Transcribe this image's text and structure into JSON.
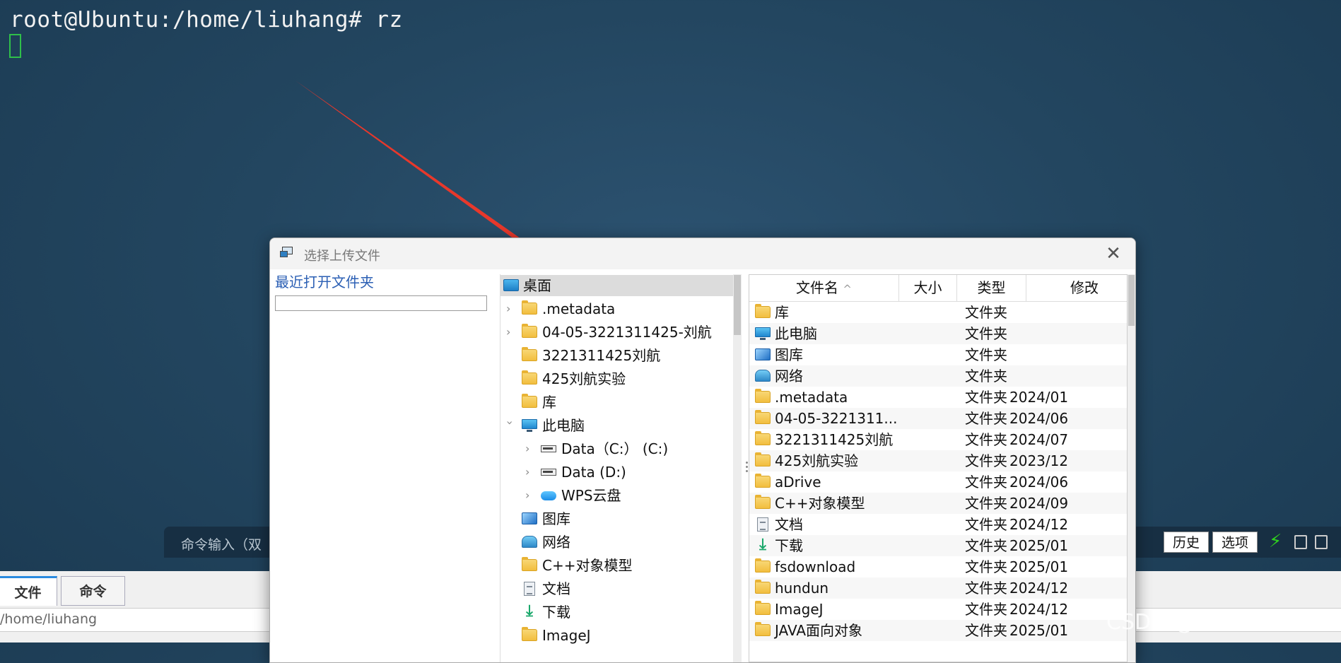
{
  "terminal": {
    "prompt_line": "root@Ubuntu:/home/liuhang# rz"
  },
  "command_bar": {
    "hint": "命令输入（双",
    "history_button": "历史",
    "options_button": "选项"
  },
  "bottom_panel": {
    "tabs": [
      {
        "label": "文件"
      },
      {
        "label": "命令"
      }
    ],
    "path": "/home/liuhang"
  },
  "dialog": {
    "title": "选择上传文件",
    "close_glyph": "✕",
    "recent_folders_label": "最近打开文件夹",
    "tree": [
      {
        "label": "桌面",
        "icon": "desktop-icon"
      },
      {
        "label": ".metadata",
        "icon": "folder-icon"
      },
      {
        "label": "04-05-3221311425-刘航",
        "icon": "folder-icon"
      },
      {
        "label": "3221311425刘航",
        "icon": "folder-icon"
      },
      {
        "label": "425刘航实验",
        "icon": "folder-icon"
      },
      {
        "label": "库",
        "icon": "folder-icon"
      },
      {
        "label": "此电脑",
        "icon": "computer-icon"
      },
      {
        "label": "Data（C:） (C:)",
        "icon": "drive-icon"
      },
      {
        "label": "Data (D:)",
        "icon": "drive-icon"
      },
      {
        "label": "WPS云盘",
        "icon": "cloud-icon"
      },
      {
        "label": "图库",
        "icon": "pictures-icon"
      },
      {
        "label": "网络",
        "icon": "network-icon"
      },
      {
        "label": "C++对象模型",
        "icon": "folder-icon"
      },
      {
        "label": "文档",
        "icon": "document-icon"
      },
      {
        "label": "下载",
        "icon": "download-icon"
      },
      {
        "label": "ImageJ",
        "icon": "folder-icon"
      }
    ],
    "columns": {
      "name": "文件名",
      "size": "大小",
      "type": "类型",
      "modified": "修改"
    },
    "sort_glyph": "^",
    "files": [
      {
        "name": "库",
        "type": "文件夹",
        "modified": "",
        "icon": "folder-icon"
      },
      {
        "name": "此电脑",
        "type": "文件夹",
        "modified": "",
        "icon": "computer-icon"
      },
      {
        "name": "图库",
        "type": "文件夹",
        "modified": "",
        "icon": "pictures-icon"
      },
      {
        "name": "网络",
        "type": "文件夹",
        "modified": "",
        "icon": "network-icon"
      },
      {
        "name": ".metadata",
        "type": "文件夹",
        "modified": "2024/01",
        "icon": "folder-icon"
      },
      {
        "name": "04-05-3221311...",
        "type": "文件夹",
        "modified": "2024/06",
        "icon": "folder-icon"
      },
      {
        "name": "3221311425刘航",
        "type": "文件夹",
        "modified": "2024/07",
        "icon": "folder-icon"
      },
      {
        "name": "425刘航实验",
        "type": "文件夹",
        "modified": "2023/12",
        "icon": "folder-icon"
      },
      {
        "name": "aDrive",
        "type": "文件夹",
        "modified": "2024/06",
        "icon": "folder-icon"
      },
      {
        "name": "C++对象模型",
        "type": "文件夹",
        "modified": "2024/09",
        "icon": "folder-icon"
      },
      {
        "name": "文档",
        "type": "文件夹",
        "modified": "2024/12",
        "icon": "document-icon"
      },
      {
        "name": "下载",
        "type": "文件夹",
        "modified": "2025/01",
        "icon": "download-icon"
      },
      {
        "name": "fsdownload",
        "type": "文件夹",
        "modified": "2025/01",
        "icon": "folder-icon"
      },
      {
        "name": "hundun",
        "type": "文件夹",
        "modified": "2024/12",
        "icon": "folder-icon"
      },
      {
        "name": "ImageJ",
        "type": "文件夹",
        "modified": "2024/12",
        "icon": "folder-icon"
      },
      {
        "name": "JAVA面向对象",
        "type": "文件夹",
        "modified": "2025/01",
        "icon": "folder-icon"
      }
    ]
  },
  "watermark": "CSDN @浅慕Antonio",
  "colors": {
    "arrow": "#e8382b",
    "accent": "#2a8be0",
    "bolt": "#2fd11e"
  }
}
